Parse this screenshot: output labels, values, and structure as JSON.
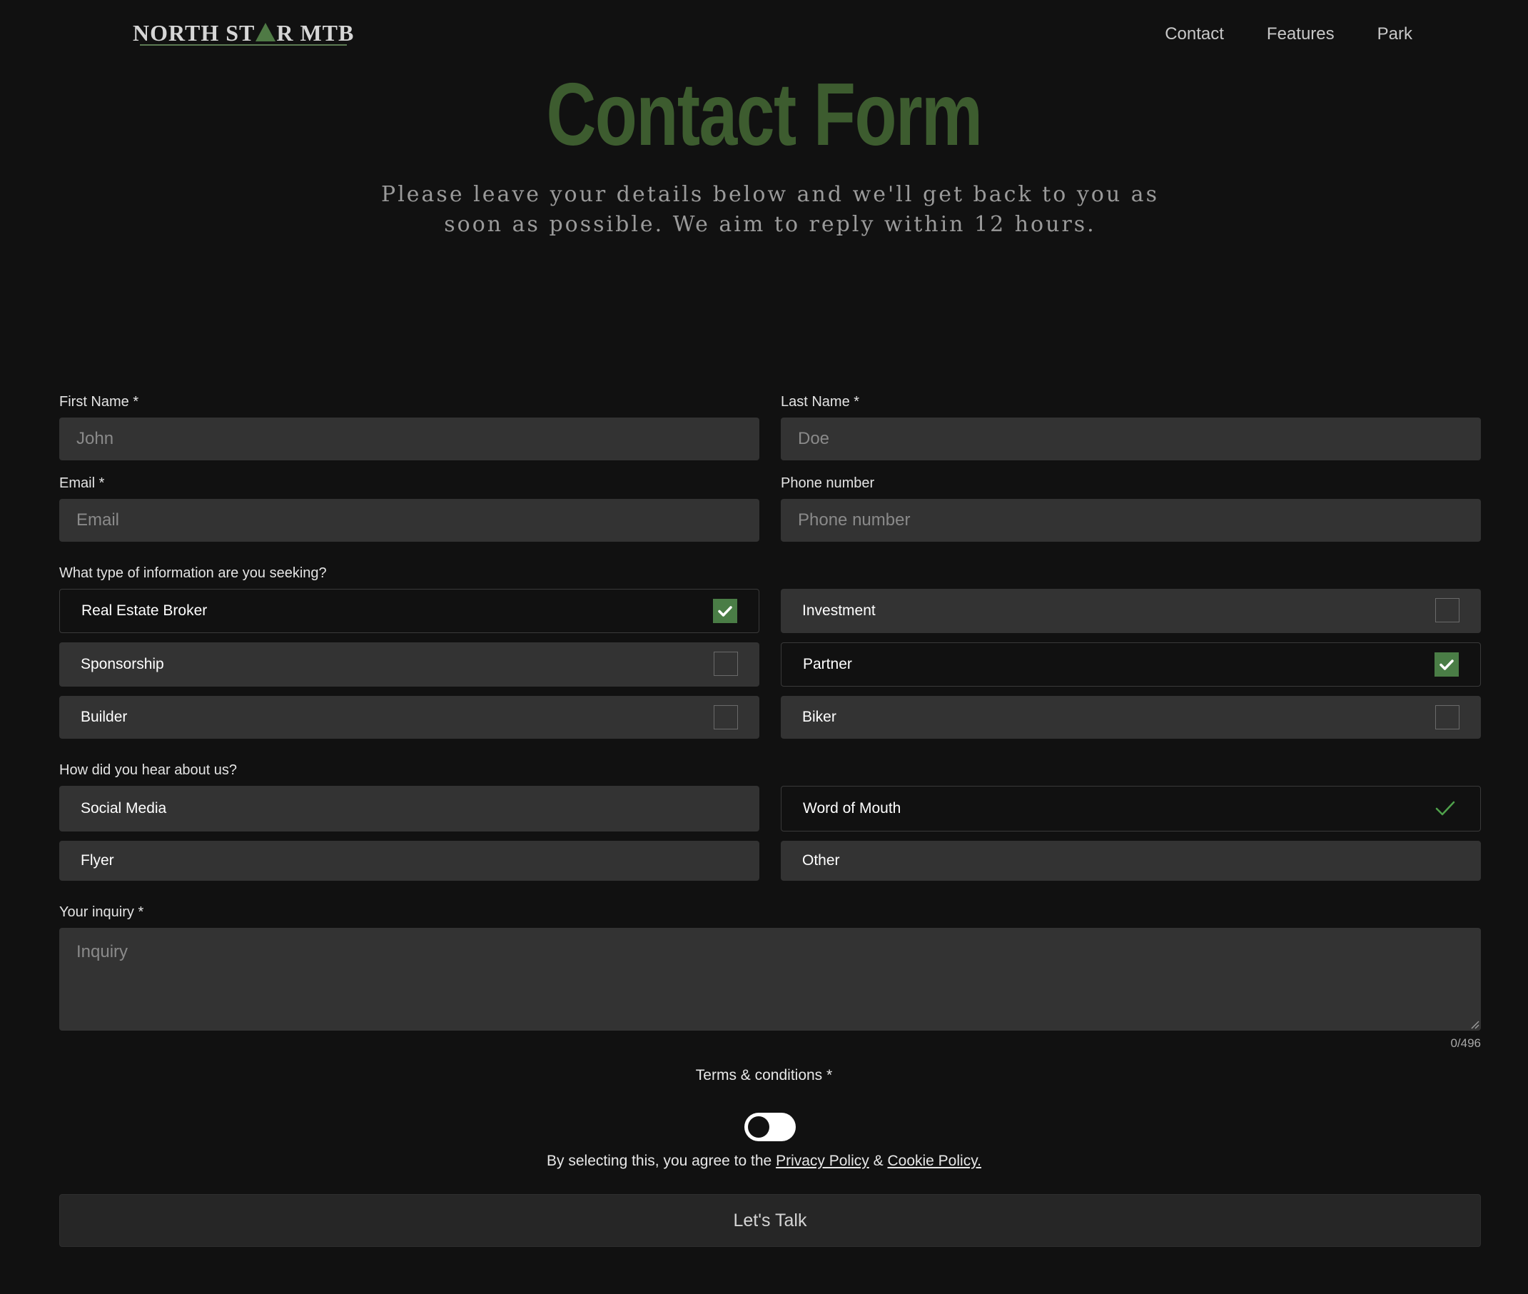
{
  "header": {
    "logo_part1": "NORTH ST",
    "logo_part2": "R MTB",
    "nav": [
      "Contact",
      "Features",
      "Park"
    ]
  },
  "hero": {
    "title": "Contact Form",
    "subtitle": "Please leave your details below and we'll get back to you as soon as possible. We aim to reply within 12 hours."
  },
  "form": {
    "first_name": {
      "label": "First Name *",
      "placeholder": "John",
      "value": ""
    },
    "last_name": {
      "label": "Last Name *",
      "placeholder": "Doe",
      "value": ""
    },
    "email": {
      "label": "Email *",
      "placeholder": "Email",
      "value": ""
    },
    "phone": {
      "label": "Phone number",
      "placeholder": "Phone number",
      "value": ""
    },
    "info_question": "What type of information are you seeking?",
    "info_options": [
      {
        "label": "Real Estate Broker",
        "checked": true
      },
      {
        "label": "Investment",
        "checked": false
      },
      {
        "label": "Sponsorship",
        "checked": false
      },
      {
        "label": "Partner",
        "checked": true
      },
      {
        "label": "Builder",
        "checked": false
      },
      {
        "label": "Biker",
        "checked": false
      }
    ],
    "hear_question": "How did you hear about us?",
    "hear_options": [
      {
        "label": "Social Media",
        "selected": false
      },
      {
        "label": "Word of Mouth",
        "selected": true
      },
      {
        "label": "Flyer",
        "selected": false
      },
      {
        "label": "Other",
        "selected": false
      }
    ],
    "inquiry": {
      "label": "Your inquiry *",
      "placeholder": "Inquiry",
      "counter": "0/496"
    },
    "terms": {
      "label": "Terms & conditions *",
      "enabled": false,
      "agree_text": "By selecting this, you agree to the",
      "privacy_link": "Privacy Policy",
      "amp": "&",
      "cookie_link": "Cookie Policy."
    },
    "submit_label": "Let's Talk"
  },
  "colors": {
    "background": "#111111",
    "title": "#3d5c2f",
    "field": "#333333",
    "accent": "#4a7d46"
  }
}
